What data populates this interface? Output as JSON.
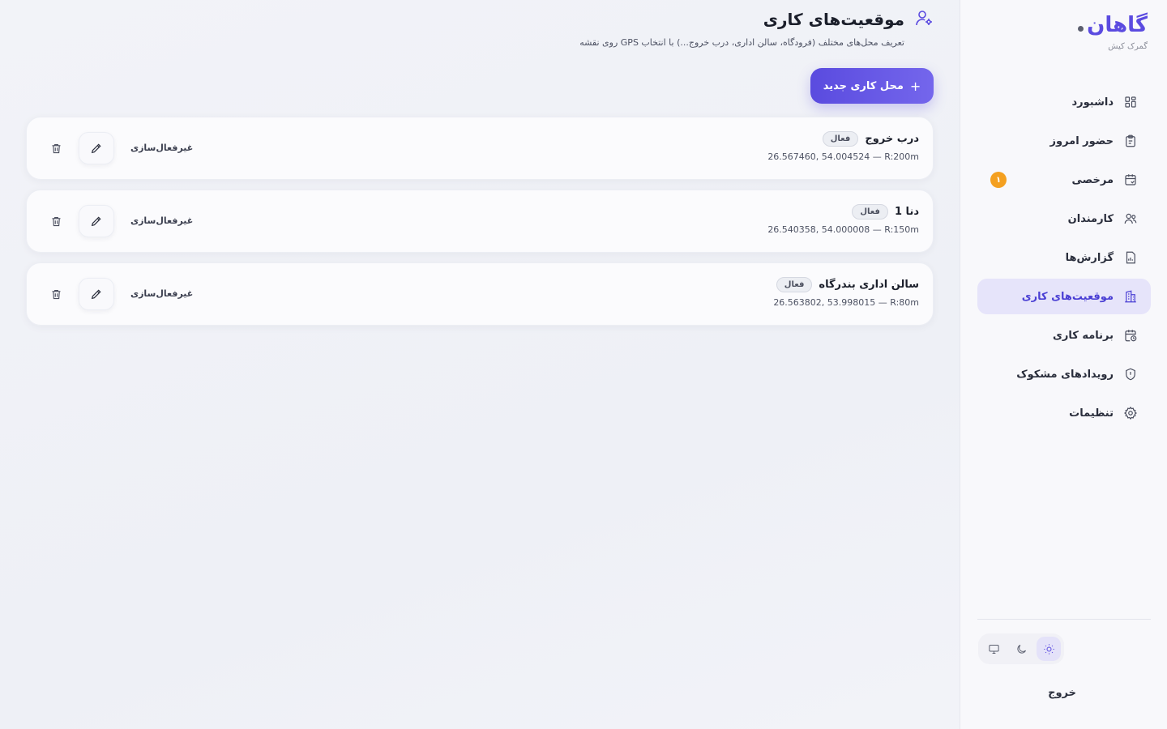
{
  "brand": {
    "name": "گاهان",
    "subtitle": "گمرک کیش"
  },
  "sidebar": {
    "items": [
      {
        "label": "داشبورد",
        "icon": "dashboard-icon"
      },
      {
        "label": "حضور امروز",
        "icon": "clipboard-icon"
      },
      {
        "label": "مرخصی",
        "icon": "calendar-icon",
        "badge": "۱"
      },
      {
        "label": "کارمندان",
        "icon": "users-icon"
      },
      {
        "label": "گزارش‌ها",
        "icon": "report-icon"
      },
      {
        "label": "موقعیت‌های کاری",
        "icon": "building-icon",
        "active": true
      },
      {
        "label": "برنامه کاری",
        "icon": "calendar-clock-icon"
      },
      {
        "label": "رویدادهای مشکوک",
        "icon": "shield-icon"
      },
      {
        "label": "تنظیمات",
        "icon": "gear-icon"
      }
    ],
    "logout_label": "خروج",
    "theme": {
      "selected": "light",
      "options": [
        "light",
        "dark",
        "system"
      ]
    }
  },
  "header": {
    "title": "موقعیت‌های کاری",
    "description": "تعریف محل‌های مختلف (فرودگاه، سالن اداری، درب خروج...) با انتخاب GPS روی نقشه"
  },
  "actions": {
    "add_label": "محل کاری جدید"
  },
  "locations": [
    {
      "name": "درب خروج",
      "status": "فعال",
      "coords": "26.567460, 54.004524 — R:200m",
      "deactivate_label": "غیرفعال‌سازی"
    },
    {
      "name": "دنا 1",
      "status": "فعال",
      "coords": "26.540358, 54.000008 — R:150m",
      "deactivate_label": "غیرفعال‌سازی"
    },
    {
      "name": "سالن اداری بندرگاه",
      "status": "فعال",
      "coords": "26.563802, 53.998015 — R:80m",
      "deactivate_label": "غیرفعال‌سازی"
    }
  ],
  "colors": {
    "accent": "#5b4be0",
    "badge": "#f4a020",
    "active_bg": "#e6e4fa"
  }
}
